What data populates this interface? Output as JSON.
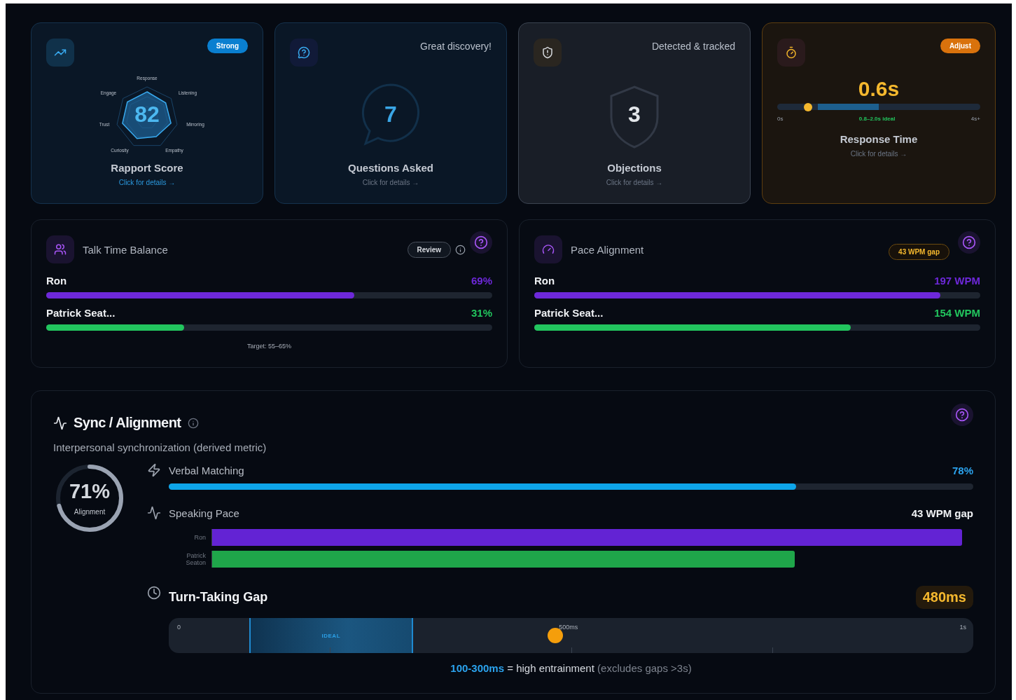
{
  "cards": [
    {
      "kind": "radar",
      "badge": {
        "text": "Strong",
        "color": "#0a7fd0"
      },
      "score": "82",
      "axes": [
        "Response",
        "Engage",
        "Listening",
        "Trust",
        "Mirroring",
        "Curiosity",
        "Empathy"
      ],
      "title": "Rapport Score",
      "link": "Click for details →"
    },
    {
      "kind": "bubble",
      "note": "Great discovery!",
      "value": "7",
      "title": "Questions Asked",
      "link": "Click for details →"
    },
    {
      "kind": "shield",
      "note": "Detected & tracked",
      "value": "3",
      "title": "Objections",
      "link": "Click for details →"
    },
    {
      "kind": "timing",
      "badge": {
        "text": "Adjust",
        "color": "#d9720c"
      },
      "value": "0.6s",
      "level": 0.15,
      "scale": [
        "0s",
        "0.8–2.0s ideal",
        "4s+"
      ],
      "title": "Response Time",
      "link": "Click for details →"
    }
  ],
  "talk_time": {
    "title": "Talk Time Balance",
    "badge": "Review",
    "speakers": [
      {
        "name": "Ron",
        "value": "69%",
        "level": 0.69,
        "color": "#6d28d9"
      },
      {
        "name": "Patrick Seat...",
        "value": "31%",
        "level": 0.31,
        "color": "#22c55e"
      }
    ],
    "target": "Target: 55–65%"
  },
  "pace": {
    "title": "Pace Alignment",
    "badge": "43 WPM gap",
    "speakers": [
      {
        "name": "Ron",
        "value": "197 WPM",
        "level": 0.91,
        "color": "#6d28d9"
      },
      {
        "name": "Patrick Seat...",
        "value": "154 WPM",
        "level": 0.71,
        "color": "#22c55e"
      }
    ]
  },
  "sync": {
    "title": "Sync / Alignment",
    "subtitle": "Interpersonal synchronization (derived metric)",
    "score": "71%",
    "score_label": "Alignment",
    "level": 0.71,
    "verbal": {
      "label": "Verbal Matching",
      "value": "78%",
      "level": 0.78
    },
    "speaking": {
      "label": "Speaking Pace",
      "value": "43 WPM gap",
      "bars": [
        {
          "name": "Ron",
          "level": 0.985,
          "color": "#6323d4"
        },
        {
          "name": "Patrick Seaton",
          "level": 0.765,
          "color": "#1fa64a"
        }
      ]
    },
    "gap": {
      "label": "Turn-Taking Gap",
      "value": "480ms",
      "level": 0.48,
      "zone": "IDEAL",
      "ticks": [
        "0",
        "500ms",
        "1s"
      ]
    },
    "footnote": {
      "highlight": "100-300ms",
      "text": "= high entrainment",
      "note": "(excludes gaps >3s)"
    }
  }
}
